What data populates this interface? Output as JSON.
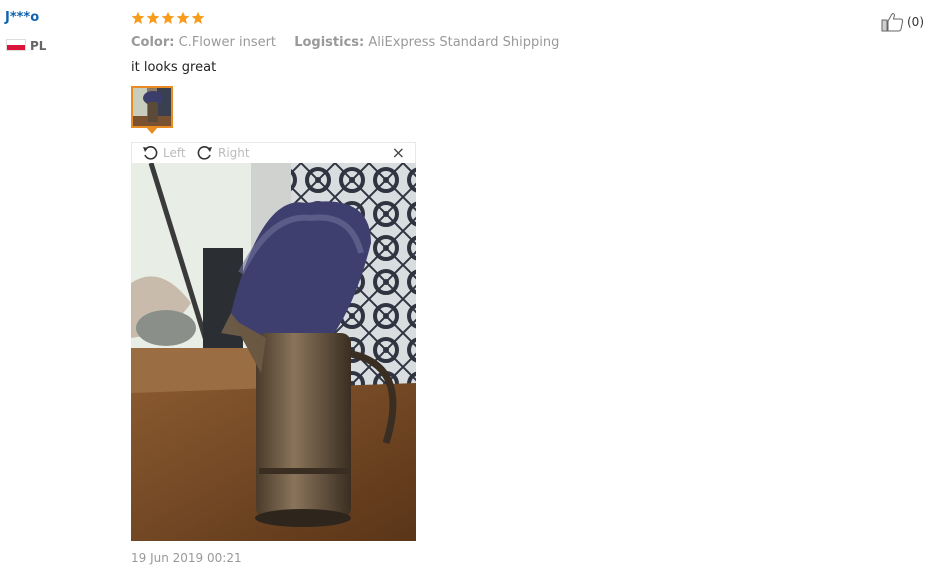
{
  "reviewer": {
    "name": "J***o",
    "country": "PL"
  },
  "rating": {
    "stars": 5,
    "max": 5,
    "star_color": "#f99b1c"
  },
  "attributes": {
    "color_label": "Color:",
    "color_value": "C.Flower insert",
    "logistics_label": "Logistics:",
    "logistics_value": "AliExpress Standard Shipping"
  },
  "review": {
    "text": "it looks great"
  },
  "viewer": {
    "rotate_left": "Left",
    "rotate_right": "Right",
    "close": "×"
  },
  "date": "19 Jun 2019 00:21",
  "helpful": {
    "count_text": "(0)"
  },
  "colors": {
    "name_link": "#0f63b0",
    "thumb_border": "#e88b23",
    "meta_text": "#999999"
  }
}
